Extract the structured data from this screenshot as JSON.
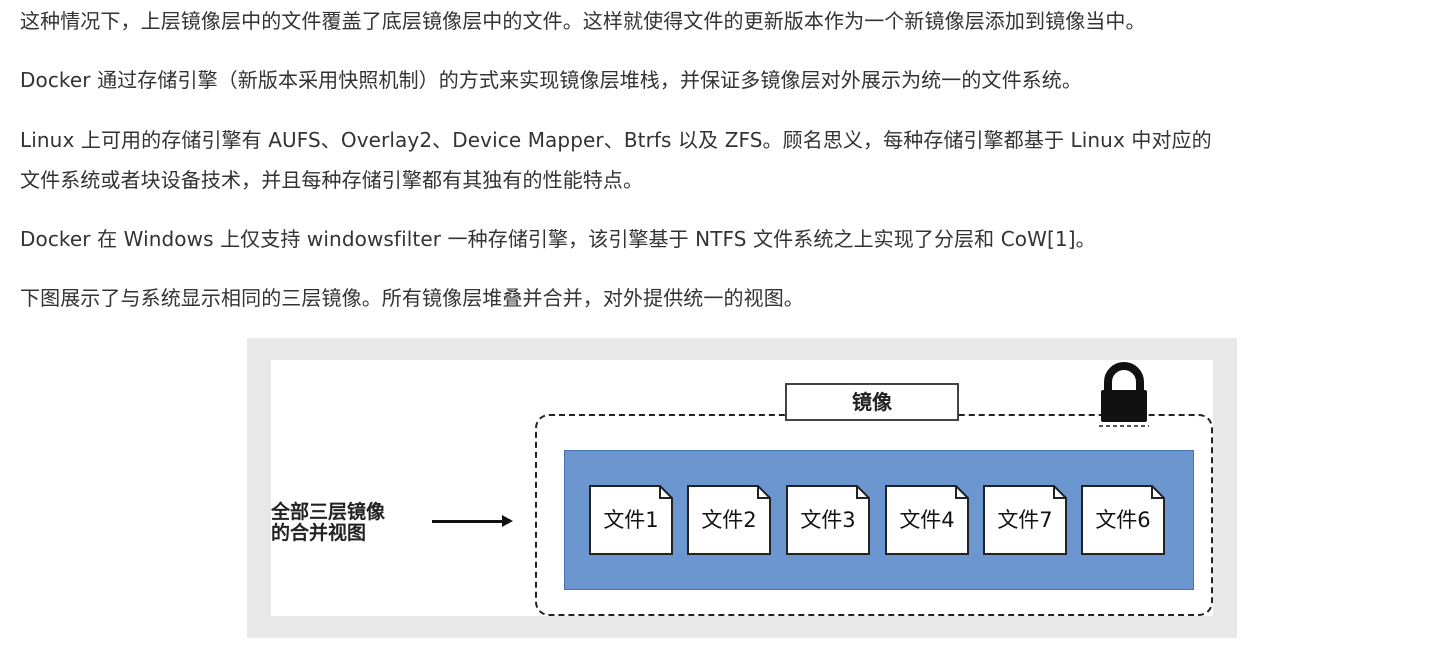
{
  "paragraphs": {
    "p1": "这种情况下，上层镜像层中的文件覆盖了底层镜像层中的文件。这样就使得文件的更新版本作为一个新镜像层添加到镜像当中。",
    "p2": "Docker 通过存储引擎（新版本采用快照机制）的方式来实现镜像层堆栈，并保证多镜像层对外展示为统一的文件系统。",
    "p3_line1": "Linux 上可用的存储引擎有 AUFS、Overlay2、Device Mapper、Btrfs 以及 ZFS。顾名思义，每种存储引擎都基于 Linux 中对应的",
    "p3_line2": "文件系统或者块设备技术，并且每种存储引擎都有其独有的性能特点。",
    "p4": "Docker 在 Windows 上仅支持 windowsfilter 一种存储引擎，该引擎基于 NTFS 文件系统之上实现了分层和 CoW[1]。",
    "p5": "下图展示了与系统显示相同的三层镜像。所有镜像层堆叠并合并，对外提供统一的视图。"
  },
  "figure": {
    "merged_label_line1": "全部三层镜像",
    "merged_label_line2": "的合并视图",
    "image_title": "镜像",
    "lock_icon": "lock-icon",
    "files": [
      "文件1",
      "文件2",
      "文件3",
      "文件4",
      "文件7",
      "文件6"
    ],
    "colors": {
      "layer_fill": "#6b96cf",
      "frame_bg": "#e8e8e8"
    }
  }
}
